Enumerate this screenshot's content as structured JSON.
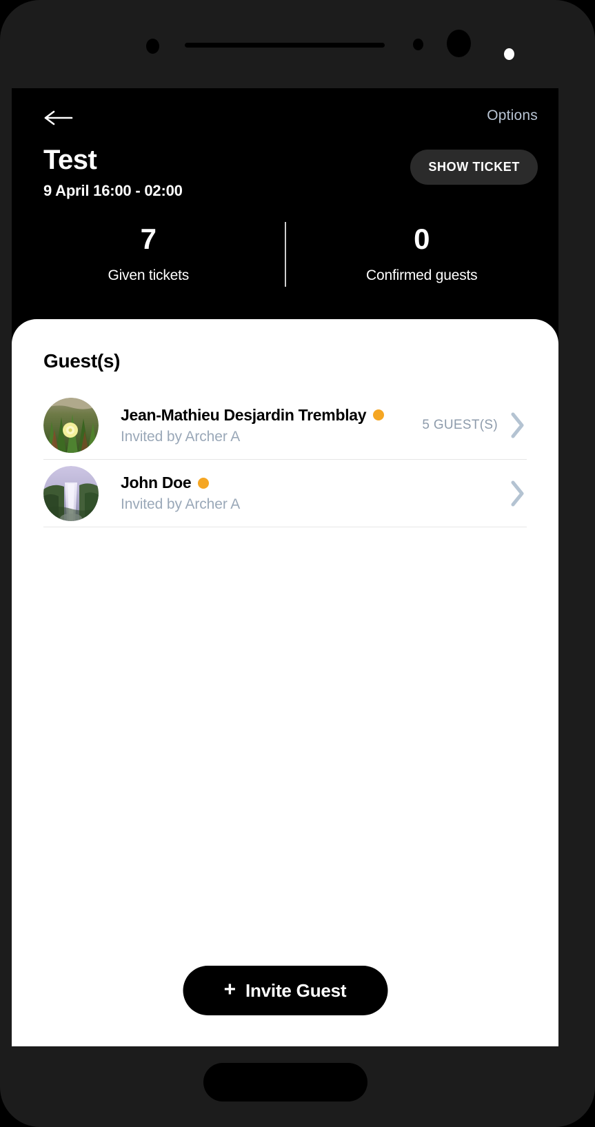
{
  "header": {
    "back_icon": "arrow-left-icon",
    "options_label": "Options",
    "event_title": "Test",
    "event_date": "9 April 16:00 - 02:00",
    "show_ticket_label": "SHOW TICKET",
    "stats": [
      {
        "value": "7",
        "label": "Given tickets"
      },
      {
        "value": "0",
        "label": "Confirmed guests"
      }
    ]
  },
  "sheet": {
    "title": "Guest(s)",
    "guests": [
      {
        "name": "Jean-Mathieu Desjardin Tremblay",
        "subtitle": "Invited by Archer A",
        "count_label": "5 GUEST(S)",
        "status_dot": "pending-status-dot",
        "avatar": "flower-photo-avatar",
        "chevron": "chevron-right-icon"
      },
      {
        "name": "John Doe",
        "subtitle": "Invited by Archer A",
        "count_label": "",
        "status_dot": "pending-status-dot",
        "avatar": "waterfall-photo-avatar",
        "chevron": "chevron-right-icon"
      }
    ],
    "invite_button_label": "Invite Guest",
    "invite_button_icon": "plus-icon"
  },
  "colors": {
    "background": "#000000",
    "sheet": "#ffffff",
    "accent_status": "#f5a623",
    "muted_text": "#9aa8b8",
    "link": "#b9c5d4",
    "chevron": "#b4c3d2",
    "pill": "#2b2b2b"
  }
}
